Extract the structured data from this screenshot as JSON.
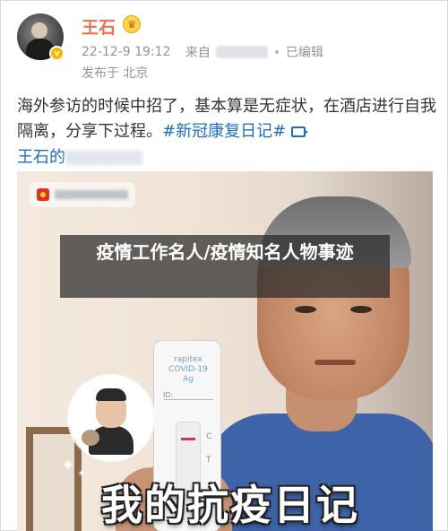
{
  "post": {
    "username": "王石",
    "level_badge": "♛",
    "verified_badge": "v",
    "timestamp": "22-12-9 19:12",
    "source_prefix": "来自",
    "edited_label": "已编辑",
    "location": "发布于 北京",
    "text_main": "海外参访的时候中招了，基本算是无症状，在酒店进行自我隔离，分享下过程。",
    "hashtag": "#新冠康复日记#",
    "line3_prefix": "王石的"
  },
  "media": {
    "test_kit_lines": [
      "rapitex",
      "COVID-19",
      "Ag"
    ],
    "test_id_label": "ID:",
    "test_c": "C",
    "test_t": "T",
    "caption": "我的抗疫日记"
  },
  "overlay": {
    "title": "疫情工作名人/疫情知名人物事迹"
  },
  "colors": {
    "username": "#eb7350",
    "link": "#1f6fbf",
    "caption": "#ffffff"
  }
}
